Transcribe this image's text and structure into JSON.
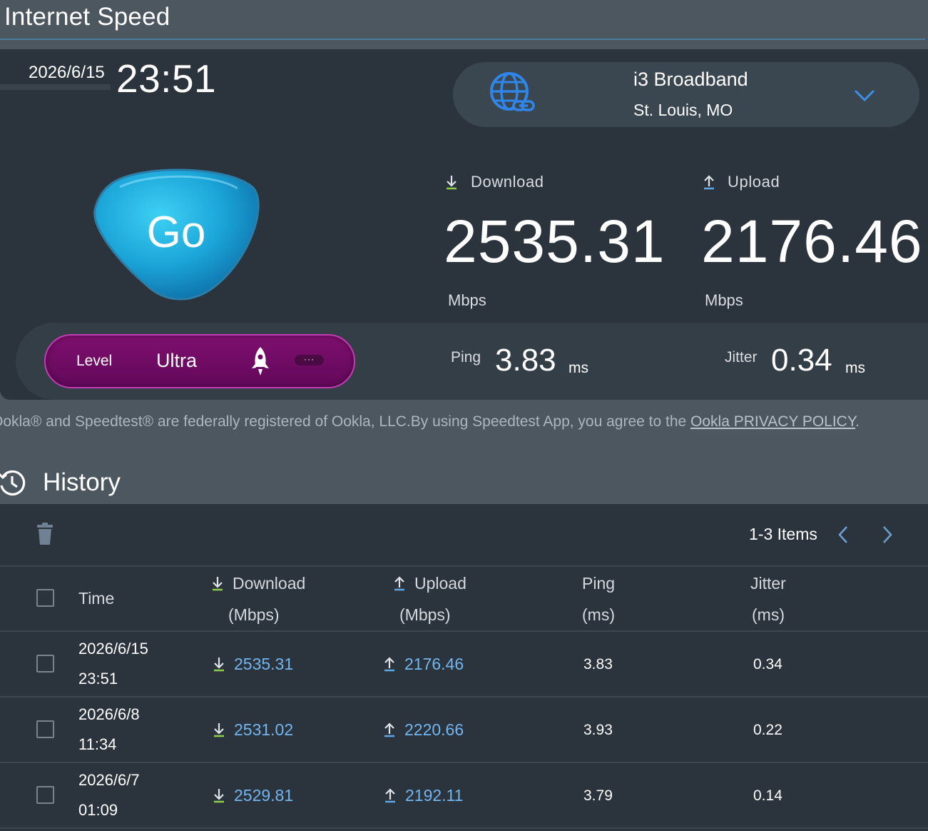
{
  "header": {
    "title": "Internet Speed"
  },
  "test": {
    "date": "2026/6/15",
    "time": "23:51",
    "go_label": "Go"
  },
  "server": {
    "name": "i3 Broadband",
    "location": "St. Louis, MO"
  },
  "metrics": {
    "download_label": "Download",
    "download_value": "2535.31",
    "download_unit": "Mbps",
    "upload_label": "Upload",
    "upload_value": "2176.46",
    "upload_unit": "Mbps",
    "ping_label": "Ping",
    "ping_value": "3.83",
    "ping_unit": "ms",
    "jitter_label": "Jitter",
    "jitter_value": "0.34",
    "jitter_unit": "ms"
  },
  "level": {
    "label": "Level",
    "value": "Ultra",
    "more": "···"
  },
  "disclaimer": {
    "text": "Ookla® and Speedtest® are federally registered of Ookla, LLC.By using Speedtest App, you agree to the ",
    "link": "Ookla PRIVACY POLICY",
    "end": "."
  },
  "history": {
    "title": "History",
    "items_count": "1-3 Items",
    "columns": {
      "time": "Time",
      "download": "Download",
      "download_unit": "(Mbps)",
      "upload": "Upload",
      "upload_unit": "(Mbps)",
      "ping": "Ping",
      "ping_unit": "(ms)",
      "jitter": "Jitter",
      "jitter_unit": "(ms)"
    },
    "rows": [
      {
        "date": "2026/6/15",
        "time": "23:51",
        "download": "2535.31",
        "upload": "2176.46",
        "ping": "3.83",
        "jitter": "0.34"
      },
      {
        "date": "2026/6/8",
        "time": "11:34",
        "download": "2531.02",
        "upload": "2220.66",
        "ping": "3.93",
        "jitter": "0.22"
      },
      {
        "date": "2026/6/7",
        "time": "01:09",
        "download": "2529.81",
        "upload": "2192.11",
        "ping": "3.79",
        "jitter": "0.14"
      }
    ]
  },
  "colors": {
    "accent_link": "#72b6f0",
    "level_pill": "#7e0f6e",
    "download_arrow": "#8ccf4a",
    "upload_arrow": "#5fa8e8"
  }
}
